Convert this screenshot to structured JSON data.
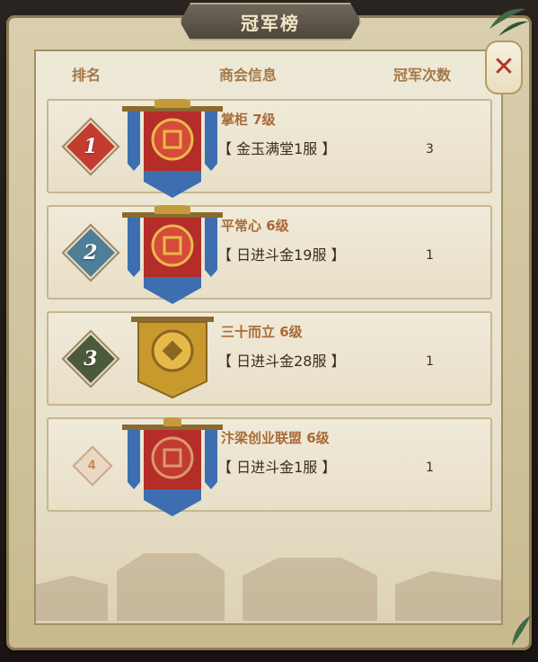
{
  "title": "冠军榜",
  "headers": {
    "rank": "排名",
    "info": "商会信息",
    "count": "冠军次数"
  },
  "colors": {
    "rank1": "#c43c30",
    "rank2": "#4f7e97",
    "rank3": "#4c5a3c",
    "accent_text": "#a86a37"
  },
  "rows": [
    {
      "rank": "1",
      "name": "掌柜 7级",
      "server": "【 金玉满堂1服 】",
      "count": "3",
      "banner": "blue-red-banner"
    },
    {
      "rank": "2",
      "name": "平常心 6级",
      "server": "【 日进斗金19服 】",
      "count": "1",
      "banner": "blue-red-banner"
    },
    {
      "rank": "3",
      "name": "三十而立 6级",
      "server": "【 日进斗金28服 】",
      "count": "1",
      "banner": "gold-banner"
    },
    {
      "rank": "4",
      "name": "汴梁创业联盟 6级",
      "server": "【 日进斗金1服 】",
      "count": "1",
      "banner": "red-blue-banner"
    }
  ]
}
